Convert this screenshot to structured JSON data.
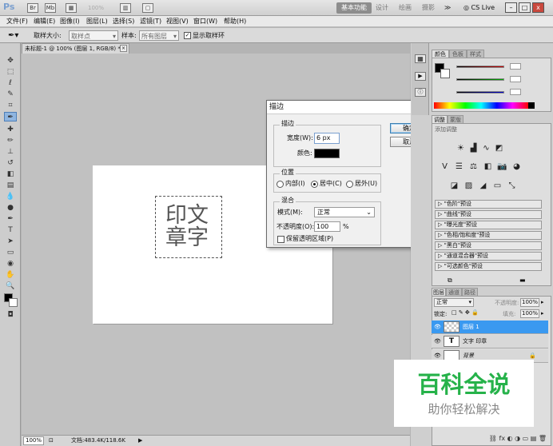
{
  "appbar": {
    "logo": "Ps",
    "zoom": "100%",
    "workspace_active": "基本功能",
    "workspaces": [
      "设计",
      "绘画",
      "摄影"
    ],
    "more": "≫",
    "cs_live": "CS Live",
    "win_min": "–",
    "win_max": "□",
    "win_close": "x"
  },
  "menus": [
    "文件(F)",
    "编辑(E)",
    "图像(I)",
    "图层(L)",
    "选择(S)",
    "滤镜(T)",
    "视图(V)",
    "窗口(W)",
    "帮助(H)"
  ],
  "options": {
    "sample_size_label": "取样大小:",
    "sample_size_value": "取样点",
    "sample_label": "样本:",
    "sample_value": "所有图层",
    "show_ring_label": "显示取样环"
  },
  "document": {
    "tab_title": "未标题-1 @ 100% (图层 1, RGB/8) *",
    "tab_close": "×",
    "text_line1": "印文",
    "text_line2": "章字"
  },
  "status": {
    "zoom": "100%",
    "doc_info": "文档:483.4K/118.6K"
  },
  "dialog": {
    "title": "描边",
    "close": "×",
    "stroke_legend": "描边",
    "width_label": "宽度(W):",
    "width_value": "6",
    "width_unit": "px",
    "color_label": "颜色:",
    "color_value": "#000000",
    "ok": "确定",
    "cancel": "取消",
    "position_legend": "位置",
    "pos_inside": "内部(I)",
    "pos_center": "居中(C)",
    "pos_outside": "居外(U)",
    "pos_selected": "center",
    "blend_legend": "混合",
    "mode_label": "模式(M):",
    "mode_value": "正常",
    "opacity_label": "不透明度(O):",
    "opacity_value": "100",
    "opacity_unit": "%",
    "preserve_label": "保留透明区域(P)"
  },
  "panels": {
    "color_tabs": [
      "颜色",
      "色板",
      "样式"
    ],
    "adj_tabs": [
      "调整",
      "蒙版"
    ],
    "adj_header": "添加调整",
    "presets": [
      "\"色阶\"预设",
      "\"曲线\"预设",
      "\"曝光度\"预设",
      "\"色相/饱和度\"预设",
      "\"黑白\"预设",
      "\"通道混合器\"预设",
      "\"可选颜色\"预设"
    ],
    "layer_tabs": [
      "图层",
      "通道",
      "路径"
    ],
    "blend_mode": "正常",
    "opacity_label": "不透明度:",
    "opacity_value": "100%",
    "lock_label": "锁定:",
    "fill_label": "填充:",
    "fill_value": "100%",
    "layers": [
      {
        "name": "图层 1",
        "type": "pixel",
        "selected": true
      },
      {
        "name": "文字 印章",
        "type": "text",
        "selected": false
      },
      {
        "name": "背景",
        "type": "background",
        "selected": false
      }
    ],
    "text_layer_icon": "T"
  },
  "watermark": {
    "title": "百科全说",
    "subtitle": "助你轻松解决"
  },
  "colors": {
    "accent": "#3399ff",
    "watermark_green": "#26b24a",
    "red_slider": "#cc0000",
    "green_slider": "#00aa00",
    "blue_slider": "#0000cc"
  }
}
